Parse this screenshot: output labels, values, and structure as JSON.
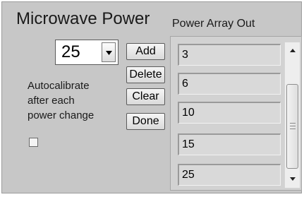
{
  "title": "Microwave Power",
  "power_select": {
    "value": "25",
    "icon": "triangle-down-icon"
  },
  "buttons": {
    "add": "Add",
    "delete": "Delete",
    "clear": "Clear",
    "done": "Done"
  },
  "autocalibrate": {
    "lines": [
      "Autocalibrate",
      "after each",
      "power change"
    ],
    "checked": false
  },
  "array_out": {
    "label": "Power Array Out",
    "items": [
      "3",
      "6",
      "10",
      "15",
      "25"
    ]
  },
  "scrollbar": {
    "up_icon": "arrow-up-icon",
    "down_icon": "arrow-down-icon",
    "grip_icon": "grip-icon"
  }
}
